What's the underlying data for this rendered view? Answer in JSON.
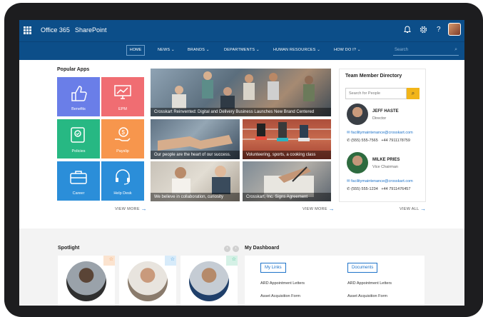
{
  "topbar": {
    "app": "Office 365",
    "site": "SharePoint",
    "icons": [
      "waffle-icon",
      "bell-icon",
      "gear-icon",
      "help-icon",
      "user-avatar"
    ]
  },
  "nav": {
    "items": [
      "HOME",
      "NEWS",
      "BRANDS",
      "DEPARTMENTS",
      "HUMAN RESOURCES",
      "HOW DO I?"
    ],
    "search_placeholder": "Search"
  },
  "popular_apps": {
    "title": "Popular Apps",
    "apps": [
      {
        "label": "Benefits",
        "color": "#6a7ee8",
        "icon": "thumbs-up-icon"
      },
      {
        "label": "EPM",
        "color": "#f06d72",
        "icon": "chart-icon"
      },
      {
        "label": "Policies",
        "color": "#27b883",
        "icon": "certificate-icon"
      },
      {
        "label": "Payslip",
        "color": "#f7964d",
        "icon": "money-hand-icon"
      },
      {
        "label": "Career",
        "color": "#2b8ed9",
        "icon": "briefcase-icon"
      },
      {
        "label": "Help Desk",
        "color": "#2b8ed9",
        "icon": "headset-icon"
      }
    ],
    "view_more": "VIEW MORE"
  },
  "news": {
    "items": [
      "Crosskart Reinvented: Digital and Delivery Business Launches New Brand Centered",
      "Our people are the heart of our success.",
      "Volunteering, sports, a cooking class",
      "We believe in collaboration, curiosity",
      "Crosskart, Inc. Signs Agreement"
    ],
    "view_more": "VIEW MORE"
  },
  "directory": {
    "title": "Team Member Directory",
    "search_placeholder": "Search for People",
    "people": [
      {
        "name": "JEFF HASTE",
        "role": "Director",
        "email": "facilitymaintenance@crosskart.com",
        "phone1": "(555) 555-7565",
        "phone2": "+44 7911178759"
      },
      {
        "name": "MILKE PRIES",
        "role": "Vice Chairman",
        "email": "facilitymaintenance@crosskart.com",
        "phone1": "(555) 555-1234",
        "phone2": "+44 7911476457"
      }
    ],
    "view_all": "VIEW ALL"
  },
  "spotlight": {
    "title": "Spotlight"
  },
  "dashboard": {
    "title": "My Dashboard",
    "tabs": [
      "My Links",
      "Documents"
    ],
    "links_left": [
      "ARD Appointment Letters",
      "Asset Acquisition Form"
    ],
    "links_right": [
      "ARD Appointment Letters",
      "Asset Acquisition Form"
    ]
  },
  "colors": {
    "header": "#0c4e89",
    "accent": "#1e73c9",
    "search_button": "#f2b519"
  }
}
